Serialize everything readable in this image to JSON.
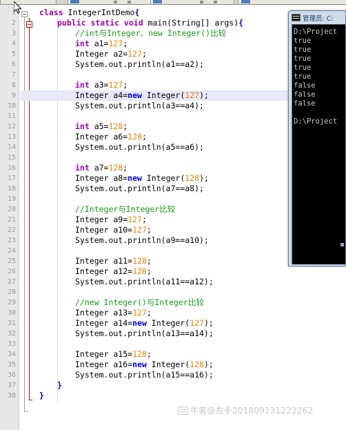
{
  "window": {
    "editor_name": "java-source-editor"
  },
  "toolbar": {
    "segments": 4
  },
  "editor": {
    "current_line": 9,
    "first_line": 1,
    "last_line": 38,
    "colors": {
      "keyword": "#9b00b0",
      "keyword_new": "#0000d0",
      "number": "#ee8000",
      "comment": "#1a9a1a",
      "brace": "#0000b0",
      "current_line_highlight": "#e8e8fa",
      "gutter_background": "#e8e8e8",
      "fold_line": "#d00000"
    },
    "line_numbers": [
      1,
      2,
      3,
      4,
      5,
      6,
      7,
      8,
      9,
      10,
      11,
      12,
      13,
      14,
      15,
      16,
      17,
      18,
      19,
      20,
      21,
      22,
      23,
      24,
      25,
      26,
      27,
      28,
      29,
      30,
      31,
      32,
      33,
      34,
      35,
      36,
      37,
      38
    ],
    "lines": [
      {
        "n": 1,
        "indent": 0,
        "tokens": [
          {
            "t": "kw",
            "s": "class"
          },
          {
            "t": "plain",
            "s": " IntegerIntDemo"
          },
          {
            "t": "brace",
            "s": "{"
          }
        ]
      },
      {
        "n": 2,
        "indent": 1,
        "tokens": [
          {
            "t": "kw",
            "s": "public static void"
          },
          {
            "t": "plain",
            "s": " main"
          },
          {
            "t": "brk",
            "s": "("
          },
          {
            "t": "plain",
            "s": "String[] args"
          },
          {
            "t": "brk",
            "s": ")"
          },
          {
            "t": "brace",
            "s": "{"
          }
        ]
      },
      {
        "n": 3,
        "indent": 2,
        "tokens": [
          {
            "t": "cmt",
            "s": "//int与Integer、new Integer()比较"
          }
        ]
      },
      {
        "n": 4,
        "indent": 2,
        "tokens": [
          {
            "t": "kw",
            "s": "int"
          },
          {
            "t": "plain",
            "s": " a1="
          },
          {
            "t": "num",
            "s": "127"
          },
          {
            "t": "plain",
            "s": ";"
          }
        ]
      },
      {
        "n": 5,
        "indent": 2,
        "tokens": [
          {
            "t": "plain",
            "s": "Integer a2="
          },
          {
            "t": "num",
            "s": "127"
          },
          {
            "t": "plain",
            "s": ";"
          }
        ]
      },
      {
        "n": 6,
        "indent": 2,
        "tokens": [
          {
            "t": "plain",
            "s": "System.out.println(a1==a2);"
          }
        ]
      },
      {
        "n": 7,
        "indent": 0,
        "tokens": []
      },
      {
        "n": 8,
        "indent": 2,
        "tokens": [
          {
            "t": "kw",
            "s": "int"
          },
          {
            "t": "plain",
            "s": " a3="
          },
          {
            "t": "num",
            "s": "127"
          },
          {
            "t": "plain",
            "s": ";"
          }
        ]
      },
      {
        "n": 9,
        "indent": 2,
        "tokens": [
          {
            "t": "plain",
            "s": "Integer a4="
          },
          {
            "t": "kw2",
            "s": "new"
          },
          {
            "t": "plain",
            "s": " Integer"
          },
          {
            "t": "brk",
            "s": "("
          },
          {
            "t": "num",
            "s": "127"
          },
          {
            "t": "brk",
            "s": ")"
          },
          {
            "t": "plain",
            "s": ";"
          }
        ]
      },
      {
        "n": 10,
        "indent": 2,
        "tokens": [
          {
            "t": "plain",
            "s": "System.out.println(a3==a4);"
          }
        ]
      },
      {
        "n": 11,
        "indent": 0,
        "tokens": []
      },
      {
        "n": 12,
        "indent": 2,
        "tokens": [
          {
            "t": "kw",
            "s": "int"
          },
          {
            "t": "plain",
            "s": " a5="
          },
          {
            "t": "num",
            "s": "128"
          },
          {
            "t": "plain",
            "s": ";"
          }
        ]
      },
      {
        "n": 13,
        "indent": 2,
        "tokens": [
          {
            "t": "plain",
            "s": "Integer a6="
          },
          {
            "t": "num",
            "s": "128"
          },
          {
            "t": "plain",
            "s": ";"
          }
        ]
      },
      {
        "n": 14,
        "indent": 2,
        "tokens": [
          {
            "t": "plain",
            "s": "System.out.println(a5==a6);"
          }
        ]
      },
      {
        "n": 15,
        "indent": 0,
        "tokens": []
      },
      {
        "n": 16,
        "indent": 2,
        "tokens": [
          {
            "t": "kw",
            "s": "int"
          },
          {
            "t": "plain",
            "s": " a7="
          },
          {
            "t": "num",
            "s": "128"
          },
          {
            "t": "plain",
            "s": ";"
          }
        ]
      },
      {
        "n": 17,
        "indent": 2,
        "tokens": [
          {
            "t": "plain",
            "s": "Integer a8="
          },
          {
            "t": "kw2",
            "s": "new"
          },
          {
            "t": "plain",
            "s": " Integer"
          },
          {
            "t": "brk",
            "s": "("
          },
          {
            "t": "num",
            "s": "128"
          },
          {
            "t": "brk",
            "s": ")"
          },
          {
            "t": "plain",
            "s": ";"
          }
        ]
      },
      {
        "n": 18,
        "indent": 2,
        "tokens": [
          {
            "t": "plain",
            "s": "System.out.println(a7==a8);"
          }
        ]
      },
      {
        "n": 19,
        "indent": 0,
        "tokens": []
      },
      {
        "n": 20,
        "indent": 2,
        "tokens": [
          {
            "t": "cmt",
            "s": "//Integer与Integer比较"
          }
        ]
      },
      {
        "n": 21,
        "indent": 2,
        "tokens": [
          {
            "t": "plain",
            "s": "Integer a9="
          },
          {
            "t": "num",
            "s": "127"
          },
          {
            "t": "plain",
            "s": ";"
          }
        ]
      },
      {
        "n": 22,
        "indent": 2,
        "tokens": [
          {
            "t": "plain",
            "s": "Integer a10="
          },
          {
            "t": "num",
            "s": "127"
          },
          {
            "t": "plain",
            "s": ";"
          }
        ]
      },
      {
        "n": 23,
        "indent": 2,
        "tokens": [
          {
            "t": "plain",
            "s": "System.out.println(a9==a10);"
          }
        ]
      },
      {
        "n": 24,
        "indent": 0,
        "tokens": []
      },
      {
        "n": 25,
        "indent": 2,
        "tokens": [
          {
            "t": "plain",
            "s": "Integer a11="
          },
          {
            "t": "num",
            "s": "128"
          },
          {
            "t": "plain",
            "s": ";"
          }
        ]
      },
      {
        "n": 26,
        "indent": 2,
        "tokens": [
          {
            "t": "plain",
            "s": "Integer a12="
          },
          {
            "t": "num",
            "s": "128"
          },
          {
            "t": "plain",
            "s": ";"
          }
        ]
      },
      {
        "n": 27,
        "indent": 2,
        "tokens": [
          {
            "t": "plain",
            "s": "System.out.println(a11==a12);"
          }
        ]
      },
      {
        "n": 28,
        "indent": 0,
        "tokens": []
      },
      {
        "n": 29,
        "indent": 2,
        "tokens": [
          {
            "t": "cmt",
            "s": "//new Integer()与Integer比较"
          }
        ]
      },
      {
        "n": 30,
        "indent": 2,
        "tokens": [
          {
            "t": "plain",
            "s": "Integer a13="
          },
          {
            "t": "num",
            "s": "127"
          },
          {
            "t": "plain",
            "s": ";"
          }
        ]
      },
      {
        "n": 31,
        "indent": 2,
        "tokens": [
          {
            "t": "plain",
            "s": "Integer a14="
          },
          {
            "t": "kw2",
            "s": "new"
          },
          {
            "t": "plain",
            "s": " Integer"
          },
          {
            "t": "brk",
            "s": "("
          },
          {
            "t": "num",
            "s": "127"
          },
          {
            "t": "brk",
            "s": ")"
          },
          {
            "t": "plain",
            "s": ";"
          }
        ]
      },
      {
        "n": 32,
        "indent": 2,
        "tokens": [
          {
            "t": "plain",
            "s": "System.out.println(a13==a14);"
          }
        ]
      },
      {
        "n": 33,
        "indent": 0,
        "tokens": []
      },
      {
        "n": 34,
        "indent": 2,
        "tokens": [
          {
            "t": "plain",
            "s": "Integer a15="
          },
          {
            "t": "num",
            "s": "128"
          },
          {
            "t": "plain",
            "s": ";"
          }
        ]
      },
      {
        "n": 35,
        "indent": 2,
        "tokens": [
          {
            "t": "plain",
            "s": "Integer a16="
          },
          {
            "t": "kw2",
            "s": "new"
          },
          {
            "t": "plain",
            "s": " Integer"
          },
          {
            "t": "brk",
            "s": "("
          },
          {
            "t": "num",
            "s": "128"
          },
          {
            "t": "brk",
            "s": ")"
          },
          {
            "t": "plain",
            "s": ";"
          }
        ]
      },
      {
        "n": 36,
        "indent": 2,
        "tokens": [
          {
            "t": "plain",
            "s": "System.out.println(a15==a16);"
          }
        ]
      },
      {
        "n": 37,
        "indent": 1,
        "tokens": [
          {
            "t": "brace",
            "s": "}"
          }
        ]
      },
      {
        "n": 38,
        "indent": 0,
        "tokens": [
          {
            "t": "brace",
            "s": "}"
          }
        ]
      }
    ]
  },
  "console": {
    "title": "管理员: C:",
    "icon": "cmd-icon",
    "output": [
      "D:\\Project",
      "true",
      "true",
      "true",
      "true",
      "true",
      "false",
      "false",
      "false",
      "",
      "D:\\Project"
    ]
  },
  "watermark": {
    "text": "牛客@左手201809131222262"
  }
}
